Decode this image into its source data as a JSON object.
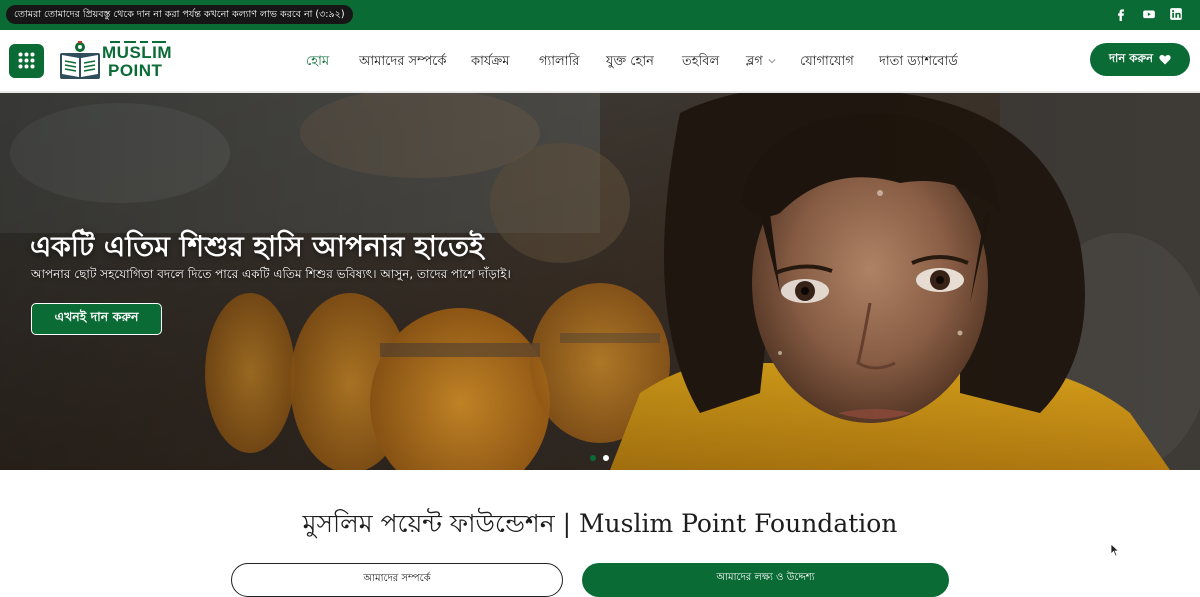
{
  "topbar": {
    "quote": "তোমরা তোমাদের প্রিয়বস্তু থেকে দান না করা পর্যন্ত কখনো কল্যাণ লাভ করবে না (৩:৯২)",
    "social": [
      "facebook-icon",
      "youtube-icon",
      "linkedin-icon"
    ]
  },
  "logo": {
    "line1": "MUSLIM",
    "line2": "POINT"
  },
  "nav": {
    "items": [
      "হোম",
      "আমাদের সম্পর্কে",
      "কার্যক্রম",
      "গ্যালারি",
      "যুক্ত হোন",
      "তহবিল",
      "ব্লগ",
      "যোগাযোগ",
      "দাতা ড্যাশবোর্ড"
    ],
    "active": "হোম"
  },
  "donate_button": "দান করুন",
  "hero": {
    "title": "একটি এতিম শিশুর হাসি আপনার হাতেই",
    "subtitle": "আপনার ছোট সহযোগিতা বদলে দিতে পারে একটি এতিম শিশুর ভবিষ্যৎ। আসুন, তাদের পাশে দাঁড়াই।",
    "button": "এখনই দান করুন",
    "slides": 2,
    "active_slide": 2
  },
  "section": {
    "title": "মুসলিম পয়েন্ট ফাউন্ডেশন | Muslim Point Foundation",
    "tabs": [
      "আমাদের সম্পর্কে",
      "আমাদের লক্ষ্য ও উদ্দেশ্য"
    ]
  },
  "colors": {
    "brand_green": "#0b6b35",
    "dark": "#161616",
    "white": "#ffffff"
  }
}
